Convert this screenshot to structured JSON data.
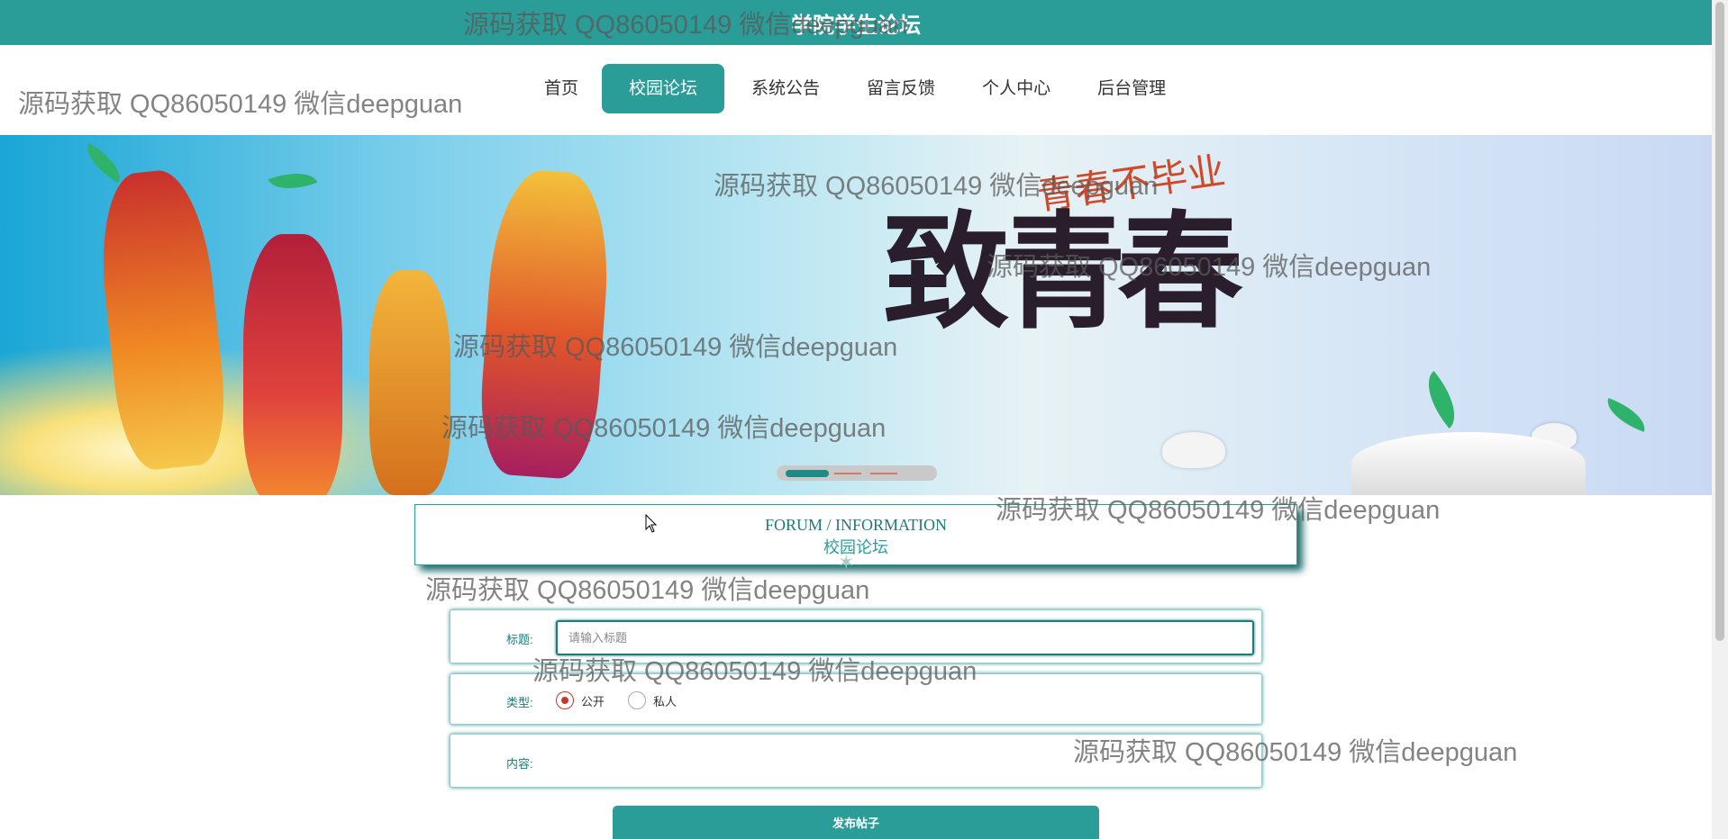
{
  "header": {
    "site_title": "学院学生论坛"
  },
  "nav": {
    "items": [
      {
        "label": "首页"
      },
      {
        "label": "校园论坛"
      },
      {
        "label": "系统公告"
      },
      {
        "label": "留言反馈"
      },
      {
        "label": "个人中心"
      },
      {
        "label": "后台管理"
      }
    ],
    "active_index": 1
  },
  "banner": {
    "title_art": "致青春",
    "subtitle_art": "青春不毕业",
    "slide_active": 1,
    "slide_count": 3
  },
  "section": {
    "title_en": "FORUM / INFORMATION",
    "title_cn": "校园论坛"
  },
  "form": {
    "title_label": "标题:",
    "title_placeholder": "请输入标题",
    "title_value": "",
    "type_label": "类型:",
    "type_options": [
      "公开",
      "私人"
    ],
    "type_selected": "公开",
    "content_label": "内容:",
    "submit_label": "发布帖子"
  },
  "watermarks": [
    "源码获取 QQ86050149 微信deepguan"
  ],
  "colors": {
    "primary": "#2a9d98",
    "primary_dark": "#1e7c78",
    "radio_checked": "#c0392b"
  }
}
